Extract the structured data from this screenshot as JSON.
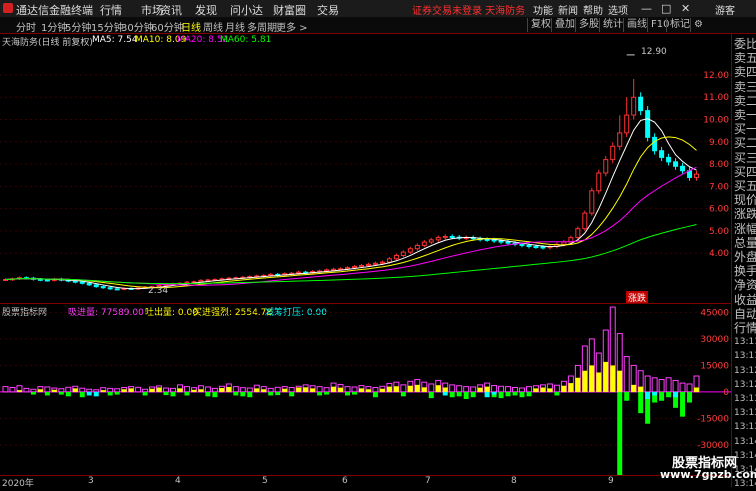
{
  "app": {
    "title": "通达信金融终端"
  },
  "menu": [
    "行情",
    "市场",
    "资讯",
    "发现",
    "问小达",
    "财富圈",
    "交易"
  ],
  "warning": "证券交易未登录 天海防务",
  "right_menu": [
    "功能",
    "新闻",
    "帮助",
    "选项",
    "游客"
  ],
  "window_buttons": [
    "—",
    "□",
    "✕"
  ],
  "periods": [
    "分时",
    "1分钟",
    "5分钟",
    "15分钟",
    "30分钟",
    "60分钟",
    "日线",
    "周线",
    "月线",
    "多周期",
    "更多 >"
  ],
  "active_period": "日线",
  "tools": [
    "复权",
    "叠加",
    "多股",
    "统计",
    "画线",
    "F10",
    "标记",
    "⚙"
  ],
  "stock": {
    "name": "天海防务(日线 前复权)"
  },
  "ma": [
    {
      "label": "MA5: 7.54",
      "color": "#ffffff"
    },
    {
      "label": "MA10: 8.09",
      "color": "#ffff00"
    },
    {
      "label": "MA20: 8.52",
      "color": "#ff00ff"
    },
    {
      "label": "MA60: 5.81",
      "color": "#00ff00"
    }
  ],
  "side_panel": [
    "委比",
    "卖五",
    "卖四",
    "卖三",
    "卖二",
    "卖一",
    "买一",
    "买二",
    "买三",
    "买四",
    "买五",
    "现价",
    "涨跌",
    "涨幅",
    "总量",
    "外盘",
    "换手",
    "净资",
    "收益",
    "自动",
    "行情",
    "13:11",
    "13:11",
    "13:12",
    "13:12",
    "13:13",
    "13:13",
    "13:13",
    "13:14",
    "13:14",
    "13:14",
    "13:14"
  ],
  "indicator": {
    "name": "股票指标网",
    "items": [
      {
        "label": "吸进量: 77589.00",
        "color": "#ff40ff"
      },
      {
        "label": "吐出量: 0.00",
        "color": "#ffff00"
      },
      {
        "label": "买进强烈: 2554.78",
        "color": "#ffff00"
      },
      {
        "label": "减筹打压: 0.00",
        "color": "#00ffff"
      }
    ]
  },
  "annotations": {
    "high": "12.90",
    "low": "2.34",
    "badge": "涨跌"
  },
  "x_labels": [
    "2020年",
    "3",
    "4",
    "5",
    "6",
    "7",
    "8",
    "9"
  ],
  "watermark": {
    "cn": "股票指标网",
    "url": "www.7gpzb.com"
  },
  "chart_data": [
    {
      "type": "candlestick",
      "title": "天海防务(日线 前复权)",
      "y_ticks": [
        4.0,
        5.0,
        6.0,
        7.0,
        8.0,
        9.0,
        10.0,
        11.0,
        12.0
      ],
      "ylim": [
        1.9,
        13.3
      ],
      "series": [
        {
          "name": "MA5",
          "value": 7.54,
          "color": "#ffffff"
        },
        {
          "name": "MA10",
          "value": 8.09,
          "color": "#ffff00"
        },
        {
          "name": "MA20",
          "value": 8.52,
          "color": "#ff00ff"
        },
        {
          "name": "MA60",
          "value": 5.81,
          "color": "#00ff00"
        }
      ],
      "close": [
        2.82,
        2.85,
        2.9,
        2.88,
        2.83,
        2.8,
        2.78,
        2.84,
        2.8,
        2.75,
        2.7,
        2.65,
        2.58,
        2.5,
        2.45,
        2.4,
        2.38,
        2.42,
        2.4,
        2.44,
        2.48,
        2.5,
        2.55,
        2.6,
        2.62,
        2.65,
        2.7,
        2.72,
        2.78,
        2.8,
        2.82,
        2.85,
        2.88,
        2.9,
        2.92,
        2.95,
        2.98,
        3.0,
        3.05,
        3.02,
        3.08,
        3.1,
        3.15,
        3.12,
        3.18,
        3.2,
        3.25,
        3.28,
        3.3,
        3.35,
        3.4,
        3.45,
        3.5,
        3.55,
        3.6,
        3.75,
        3.9,
        4.05,
        4.2,
        4.35,
        4.5,
        4.6,
        4.7,
        4.75,
        4.72,
        4.68,
        4.7,
        4.65,
        4.62,
        4.6,
        4.55,
        4.5,
        4.45,
        4.4,
        4.35,
        4.3,
        4.28,
        4.25,
        4.3,
        4.4,
        4.5,
        4.7,
        5.1,
        5.8,
        6.8,
        7.6,
        8.2,
        8.8,
        9.4,
        10.2,
        11.0,
        10.4,
        9.2,
        8.6,
        8.3,
        8.1,
        7.9,
        7.7,
        7.4,
        7.55
      ],
      "highlights": {
        "high": 12.9,
        "low": 2.34
      }
    },
    {
      "type": "bar",
      "title": "股票指标网",
      "y_ticks": [
        -30000,
        -15000,
        0,
        15000,
        30000,
        45000
      ],
      "ylim": [
        -47000,
        52000
      ],
      "series": [
        {
          "name": "吸进量",
          "color": "#ff40ff",
          "values": [
            3000,
            2500,
            3500,
            2000,
            1500,
            3000,
            2800,
            2200,
            1800,
            2600,
            3200,
            2100,
            1500,
            1200,
            2400,
            2000,
            1800,
            2500,
            3000,
            2600,
            1500,
            2800,
            3400,
            2200,
            2000,
            4000,
            3000,
            2400,
            3500,
            2800,
            2000,
            3200,
            4500,
            3000,
            2400,
            2200,
            3800,
            3000,
            2000,
            2600,
            3000,
            2500,
            3200,
            4000,
            3500,
            3000,
            2400,
            5000,
            4200,
            3000,
            2800,
            3600,
            3000,
            2500,
            3200,
            4800,
            5500,
            4000,
            6000,
            7000,
            5500,
            4500,
            6500,
            5000,
            4000,
            3500,
            3000,
            2800,
            4000,
            5000,
            3600,
            3200,
            3000,
            2500,
            2200,
            3000,
            3500,
            4000,
            4500,
            3800,
            6000,
            9000,
            15000,
            26000,
            30000,
            22000,
            35000,
            48000,
            33000,
            20000,
            15000,
            12000,
            9000,
            8000,
            7000,
            8000,
            6500,
            5000,
            4500,
            9000
          ]
        },
        {
          "name": "买进强烈",
          "color": "#ffff00",
          "values": [
            0,
            0,
            1000,
            0,
            0,
            1500,
            0,
            1200,
            0,
            0,
            2000,
            0,
            0,
            0,
            1000,
            0,
            0,
            1500,
            2000,
            0,
            0,
            1800,
            2500,
            0,
            0,
            2000,
            0,
            1200,
            1500,
            0,
            0,
            2200,
            2800,
            0,
            0,
            0,
            2000,
            1500,
            0,
            0,
            1800,
            0,
            2500,
            2600,
            2000,
            0,
            0,
            3000,
            2400,
            0,
            0,
            2000,
            1500,
            0,
            1800,
            3000,
            3200,
            0,
            3500,
            4000,
            2600,
            0,
            3800,
            2500,
            0,
            0,
            0,
            0,
            2400,
            3000,
            0,
            0,
            0,
            0,
            0,
            0,
            2000,
            2500,
            2000,
            0,
            3500,
            5000,
            8000,
            12000,
            15000,
            11000,
            17000,
            15000,
            12000,
            0,
            4000,
            3000,
            0,
            0,
            0,
            0,
            0,
            0,
            0,
            2500
          ]
        },
        {
          "name": "减筹打压",
          "color": "#00ffff",
          "values": [
            0,
            0,
            0,
            0,
            0,
            0,
            0,
            0,
            0,
            0,
            0,
            0,
            -2000,
            -2500,
            0,
            0,
            0,
            0,
            0,
            0,
            0,
            0,
            0,
            0,
            0,
            0,
            0,
            0,
            0,
            0,
            0,
            0,
            0,
            0,
            0,
            0,
            0,
            0,
            0,
            0,
            0,
            0,
            0,
            0,
            0,
            0,
            0,
            0,
            0,
            0,
            0,
            0,
            0,
            0,
            0,
            0,
            0,
            0,
            0,
            0,
            0,
            0,
            0,
            -2000,
            0,
            0,
            0,
            0,
            0,
            -3000,
            -1500,
            0,
            0,
            0,
            0,
            0,
            0,
            0,
            0,
            0,
            0,
            0,
            0,
            0,
            0,
            0,
            0,
            0,
            0,
            0,
            0,
            0,
            -4000,
            -2000,
            0,
            0,
            -3000,
            0,
            0,
            0
          ]
        },
        {
          "name": "吐出量",
          "color": "#00ff00",
          "values": [
            0,
            0,
            0,
            0,
            -1500,
            0,
            -2000,
            0,
            -1500,
            -2500,
            0,
            -3000,
            0,
            0,
            0,
            -2000,
            -1500,
            0,
            0,
            0,
            -2000,
            0,
            0,
            -1800,
            -2500,
            0,
            -2000,
            0,
            0,
            -2500,
            -3000,
            0,
            0,
            -2000,
            -2500,
            -3000,
            0,
            0,
            -2000,
            -1800,
            0,
            -2500,
            0,
            0,
            0,
            -2000,
            -1500,
            0,
            0,
            -2000,
            -1500,
            0,
            0,
            -3000,
            0,
            0,
            0,
            -2500,
            0,
            0,
            0,
            -3500,
            0,
            0,
            -3000,
            -2500,
            -4000,
            -3000,
            0,
            0,
            -3000,
            -3500,
            -2500,
            -2000,
            -3000,
            -2500,
            0,
            0,
            0,
            -2000,
            0,
            0,
            0,
            0,
            0,
            0,
            0,
            0,
            -47000,
            -5000,
            0,
            -12000,
            -18000,
            -6000,
            -5000,
            -3000,
            -9000,
            -14000,
            -6000,
            0
          ]
        }
      ]
    }
  ]
}
